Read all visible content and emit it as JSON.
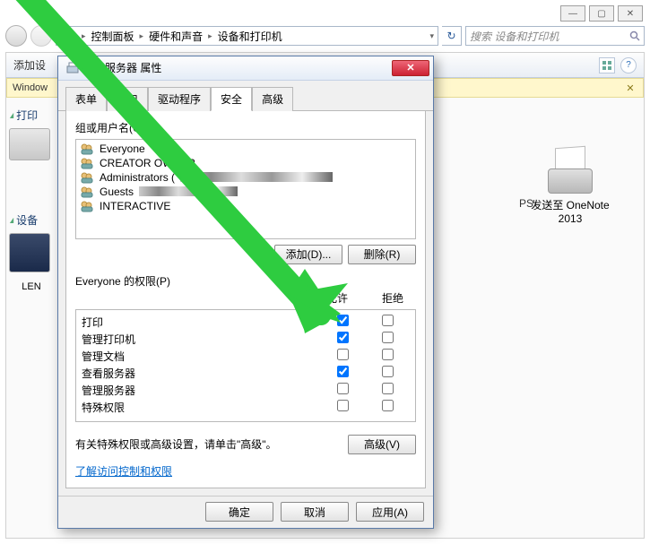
{
  "window_controls": {
    "min": "—",
    "max": "▢",
    "close": "✕"
  },
  "breadcrumb": {
    "items": [
      "控制面板",
      "硬件和声音",
      "设备和打印机"
    ],
    "refresh_icon": "↻"
  },
  "search": {
    "placeholder": "搜索 设备和打印机"
  },
  "command_bar": {
    "left_text": "添加设",
    "help_icon": "?"
  },
  "yellow_banner": {
    "text": "Window",
    "close": "✕"
  },
  "left_categories": {
    "printers": "打印",
    "devices": "设备",
    "len_label": "LEN"
  },
  "right_items": {
    "partial": "PS",
    "onenote_line1": "发送至 OneNote",
    "onenote_line2": "2013"
  },
  "dialog": {
    "title": "打印服务器 属性",
    "close": "✕",
    "tabs": [
      "表单",
      "端口",
      "驱动程序",
      "安全",
      "高级"
    ],
    "active_tab": 3,
    "groups_label": "组或用户名(G):",
    "groups": [
      {
        "name": "Everyone"
      },
      {
        "name": "CREATOR OWNER"
      },
      {
        "name": "Administrators (",
        "blur_w": 170
      },
      {
        "name": "Guests",
        "blur_w": 110
      },
      {
        "name": "INTERACTIVE"
      }
    ],
    "add_btn": "添加(D)...",
    "remove_btn": "删除(R)",
    "perm_label": "Everyone 的权限(P)",
    "allow_header": "允许",
    "deny_header": "拒绝",
    "permissions": [
      {
        "name": "打印",
        "allow": true,
        "deny": false
      },
      {
        "name": "管理打印机",
        "allow": true,
        "deny": false
      },
      {
        "name": "管理文档",
        "allow": false,
        "deny": false
      },
      {
        "name": "查看服务器",
        "allow": true,
        "deny": false
      },
      {
        "name": "管理服务器",
        "allow": false,
        "deny": false
      },
      {
        "name": "特殊权限",
        "allow": false,
        "deny": false
      }
    ],
    "special_note": "有关特殊权限或高级设置，请单击\"高级\"。",
    "advanced_btn": "高级(V)",
    "link": "了解访问控制和权限",
    "ok": "确定",
    "cancel": "取消",
    "apply": "应用(A)"
  }
}
